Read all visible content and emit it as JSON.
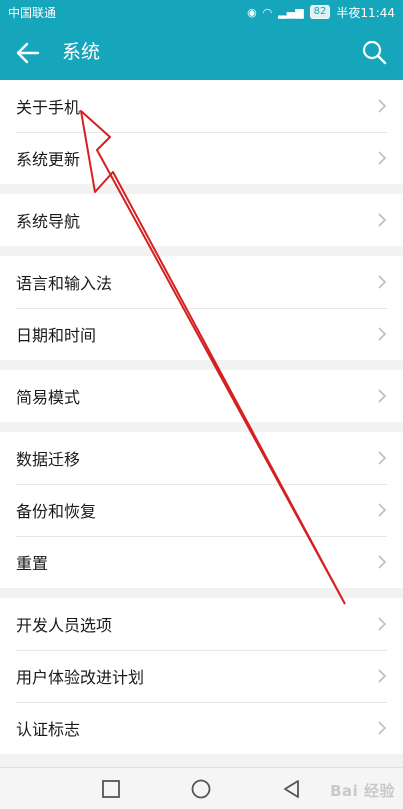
{
  "status_bar": {
    "carrier": "中国联通",
    "battery": "82",
    "time": "半夜11:44"
  },
  "toolbar": {
    "title": "系统"
  },
  "groups": [
    {
      "items": [
        "关于手机",
        "系统更新"
      ]
    },
    {
      "items": [
        "系统导航"
      ]
    },
    {
      "items": [
        "语言和输入法",
        "日期和时间"
      ]
    },
    {
      "items": [
        "简易模式"
      ]
    },
    {
      "items": [
        "数据迁移",
        "备份和恢复",
        "重置"
      ]
    },
    {
      "items": [
        "开发人员选项",
        "用户体验改进计划",
        "认证标志"
      ]
    }
  ],
  "annotation": {
    "color": "#d42020"
  },
  "watermark": {
    "text": "Bai 经验"
  },
  "colors": {
    "header": "#16a6bc",
    "chevron": "#bdbdbd"
  }
}
